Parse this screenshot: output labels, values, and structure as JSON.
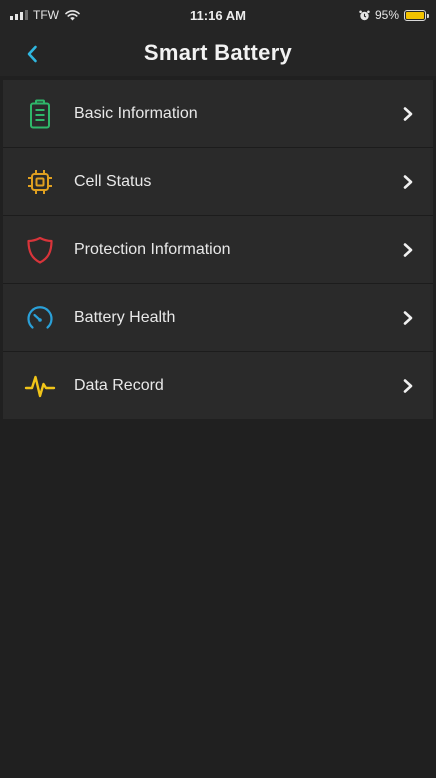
{
  "status_bar": {
    "carrier": "TFW",
    "time": "11:16 AM",
    "battery_percent_label": "95%",
    "battery_level": 0.95,
    "battery_color": "#f2c200"
  },
  "nav": {
    "title": "Smart Battery",
    "back_icon": "chevron-left-icon",
    "accent_color": "#2fb7e0"
  },
  "menu": {
    "items": [
      {
        "label": "Basic Information",
        "icon": "battery-icon",
        "color": "#2fb86a"
      },
      {
        "label": "Cell Status",
        "icon": "cell-chip-icon",
        "color": "#e0a020"
      },
      {
        "label": "Protection Information",
        "icon": "shield-icon",
        "color": "#d8343a"
      },
      {
        "label": "Battery Health",
        "icon": "gauge-icon",
        "color": "#2aa0d8"
      },
      {
        "label": "Data Record",
        "icon": "pulse-icon",
        "color": "#f0c419"
      }
    ]
  }
}
